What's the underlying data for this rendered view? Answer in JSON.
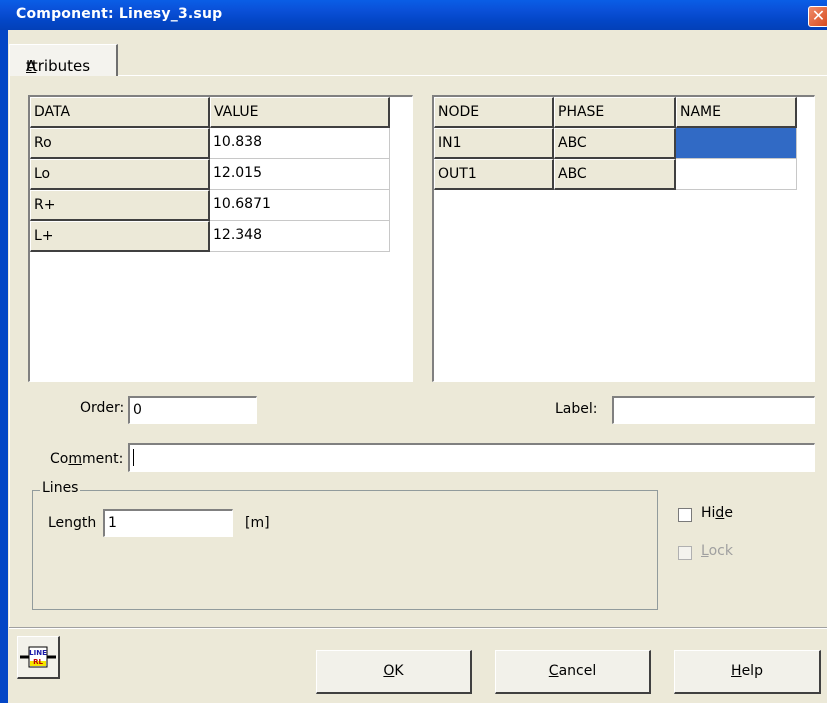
{
  "window": {
    "title": "Component: Linesy_3.sup",
    "close_glyph": "✕"
  },
  "tab": {
    "label_u": "A",
    "label_rest": "ttributes"
  },
  "data_table": {
    "headers": [
      "DATA",
      "VALUE"
    ],
    "rows": [
      [
        "Ro",
        "10.838"
      ],
      [
        "Lo",
        "12.015"
      ],
      [
        "R+",
        "10.6871"
      ],
      [
        "L+",
        "12.348"
      ]
    ]
  },
  "node_table": {
    "headers": [
      "NODE",
      "PHASE",
      "NAME"
    ],
    "rows": [
      [
        "IN1",
        "ABC",
        ""
      ],
      [
        "OUT1",
        "ABC",
        ""
      ]
    ]
  },
  "order": {
    "label": "Order:",
    "value": "0"
  },
  "label_field": {
    "label": "Label:",
    "value": ""
  },
  "comment": {
    "label_pre": "Co",
    "label_u": "m",
    "label_post": "ment:",
    "value": ""
  },
  "lines_group": {
    "title": "Lines",
    "length_label": "Length",
    "length_value": "1",
    "unit": "[m]"
  },
  "hide": {
    "label_pre": "Hi",
    "label_u": "d",
    "label_post": "e",
    "checked": false
  },
  "lock": {
    "label_u": "L",
    "label_post": "ock",
    "checked": false,
    "disabled": true
  },
  "buttons": {
    "ok": {
      "u": "O",
      "rest": "K"
    },
    "cancel": {
      "u": "C",
      "rest": "ancel"
    },
    "help": {
      "u": "H",
      "rest": "elp"
    }
  },
  "component_icon": {
    "line1": "LINE",
    "line2": "RL",
    "name": "line-rl-icon"
  }
}
